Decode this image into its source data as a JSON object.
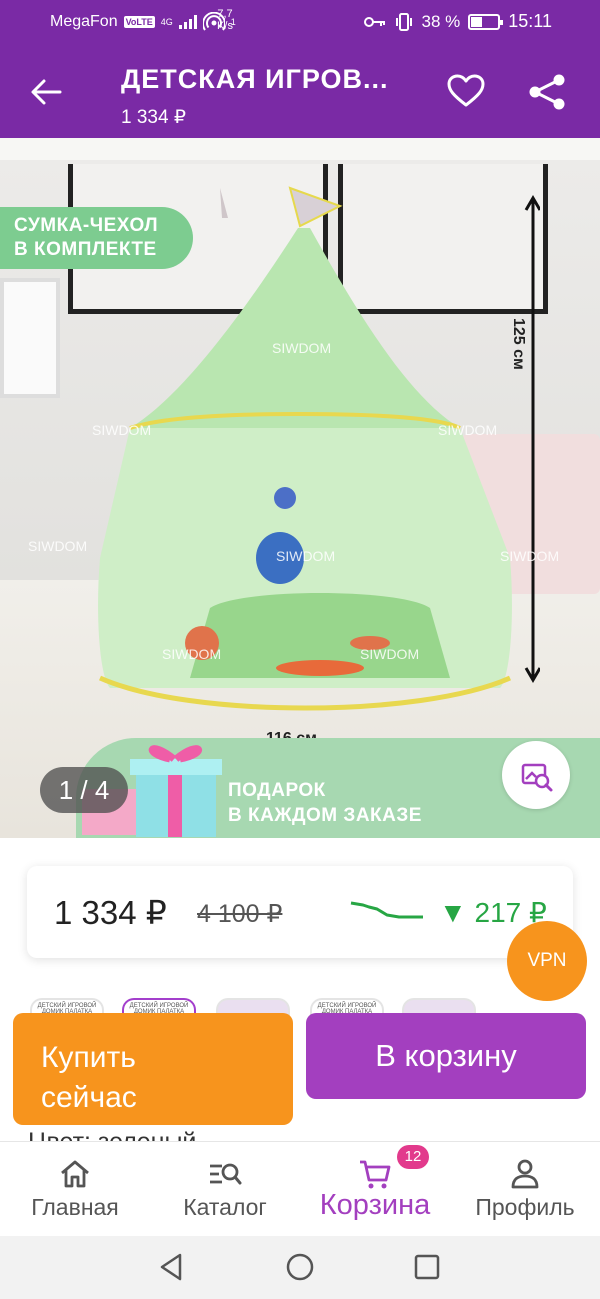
{
  "status_bar": {
    "carrier": "MegaFon",
    "volte": "VoLTE",
    "network": "4G",
    "hotspot_count": "1",
    "speed_value": "7,7",
    "speed_unit": "K/s",
    "battery": "38 %",
    "battery_level": 0.38,
    "time": "15:11"
  },
  "app_bar": {
    "title": "ДЕТСКАЯ ИГРОВ...",
    "price": "1 334 ₽",
    "back_icon": "arrow-left-icon",
    "favorite_icon": "heart-outline-icon",
    "share_icon": "share-icon"
  },
  "product_image": {
    "badge": "СУМКА-ЧЕХОЛ\nВ КОМПЛЕКТЕ",
    "height_label": "125 см",
    "width_label": "116 см",
    "watermark": "SIWDOM",
    "gift_text": "ПОДАРОК\nВ КАЖДОМ ЗАКАЗЕ",
    "counter": "1 / 4",
    "zoom_icon": "image-search-icon"
  },
  "price_card": {
    "current": "1 334 ₽",
    "old": "4 100 ₽",
    "drop_arrow": "▼",
    "drop_amount": "217 ₽"
  },
  "vpn_badge": "VPN",
  "thumbnails": [
    {
      "label": "ДЕТСКИЙ ИГРОВОЙ ДОМИК ПАЛАТКА",
      "active": false
    },
    {
      "label": "ДЕТСКИЙ ИГРОВОЙ ДОМИК ПАЛАТКА",
      "active": true
    },
    {
      "label": "",
      "active": false
    },
    {
      "label": "ДЕТСКИЙ ИГРОВОЙ ДОМИК ПАЛАТКА",
      "active": false
    },
    {
      "label": "",
      "active": false
    }
  ],
  "actions": {
    "buy_now": "Купить\nсейчас",
    "add_to_cart": "В корзину"
  },
  "color_row": "Цвет: зеленый",
  "bottom_nav": [
    {
      "label": "Главная",
      "icon": "home-icon"
    },
    {
      "label": "Каталог",
      "icon": "catalog-search-icon"
    },
    {
      "label": "Корзина",
      "icon": "cart-icon",
      "badge": "12",
      "active": true
    },
    {
      "label": "Профиль",
      "icon": "profile-icon"
    }
  ],
  "colors": {
    "brand_purple": "#7a2aa5",
    "cart_purple": "#a33fbf",
    "orange": "#f7941d",
    "price_drop_green": "#27a644"
  }
}
